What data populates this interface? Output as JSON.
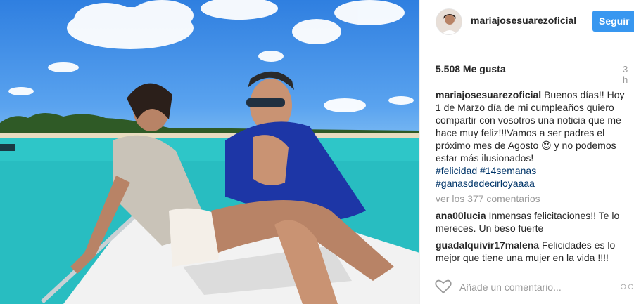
{
  "post": {
    "image_alt": "Photo of a couple on a boat",
    "colors": {
      "follow_blue": "#3897f0",
      "hashtag": "#003569",
      "muted": "#999999"
    }
  },
  "header": {
    "username": "mariajosesuarezoficial",
    "follow_label": "Seguir"
  },
  "stats": {
    "likes": "5.508 Me gusta",
    "time": "3 h"
  },
  "caption": {
    "username": "mariajosesuarezoficial",
    "text": "Buenos días!! Hoy 1 de Marzo día de mi cumpleaños quiero compartir con vosotros una noticia que me hace muy feliz!!!Vamos a ser padres el próximo mes de Agosto 😍 y no podemos estar más ilusionados!",
    "hashtags": [
      "#felicidad",
      "#14semanas",
      "#ganasdedecirloyaaaa"
    ]
  },
  "view_all_comments": "ver los 377 comentarios",
  "comments": [
    {
      "username": "ana00lucia",
      "text": "Inmensas felicitaciones!! Te lo mereces. Un beso fuerte"
    },
    {
      "username": "guadalquivir17malena",
      "text": "Felicidades es lo mejor que tiene una mujer en la vida !!!!"
    }
  ],
  "footer": {
    "add_comment_placeholder": "Añade un comentario...",
    "more_icon": "more-options-icon",
    "like_icon": "heart-icon"
  }
}
